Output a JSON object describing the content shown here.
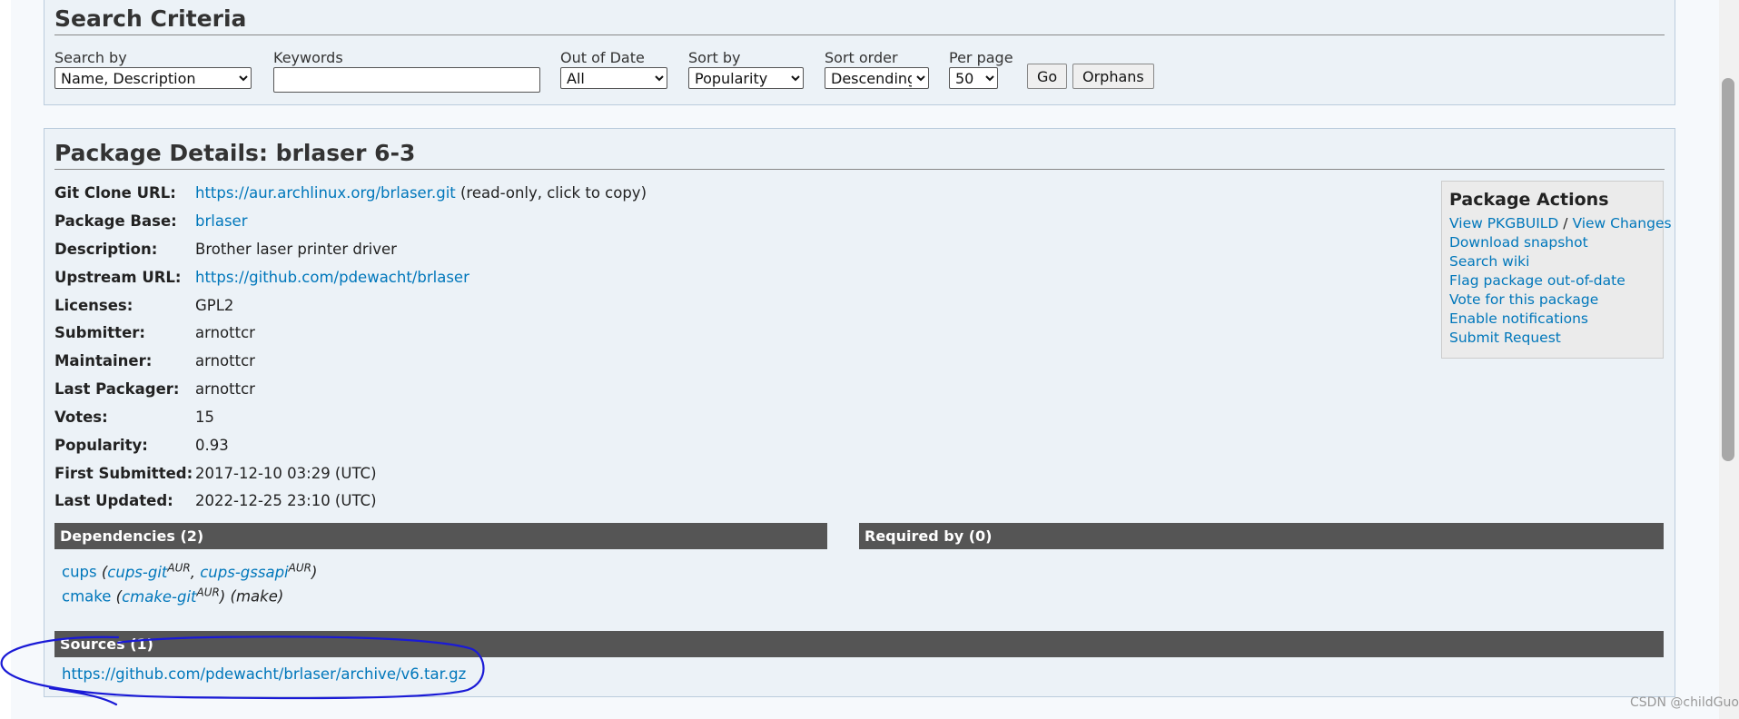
{
  "search": {
    "heading": "Search Criteria",
    "search_by": {
      "label": "Search by",
      "value": "Name, Description"
    },
    "keywords": {
      "label": "Keywords",
      "value": ""
    },
    "out_of_date": {
      "label": "Out of Date",
      "value": "All"
    },
    "sort_by": {
      "label": "Sort by",
      "value": "Popularity"
    },
    "sort_order": {
      "label": "Sort order",
      "value": "Descending"
    },
    "per_page": {
      "label": "Per page",
      "value": "50"
    },
    "go_label": "Go",
    "orphans_label": "Orphans"
  },
  "details": {
    "heading": "Package Details: brlaser 6-3",
    "rows": [
      {
        "label": "Git Clone URL:",
        "value": "https://aur.archlinux.org/brlaser.git",
        "extra": " (read-only, click to copy)"
      },
      {
        "label": "Package Base:",
        "value": "brlaser"
      },
      {
        "label": "Description:",
        "value": "Brother laser printer driver"
      },
      {
        "label": "Upstream URL:",
        "value": "https://github.com/pdewacht/brlaser"
      },
      {
        "label": "Licenses:",
        "value": "GPL2"
      },
      {
        "label": "Submitter:",
        "value": "arnottcr"
      },
      {
        "label": "Maintainer:",
        "value": "arnottcr"
      },
      {
        "label": "Last Packager:",
        "value": "arnottcr"
      },
      {
        "label": "Votes:",
        "value": "15"
      },
      {
        "label": "Popularity:",
        "value": "0.93"
      },
      {
        "label": "First Submitted:",
        "value": "2017-12-10 03:29 (UTC)"
      },
      {
        "label": "Last Updated:",
        "value": "2022-12-25 23:10 (UTC)"
      }
    ]
  },
  "actions": {
    "title": "Package Actions",
    "view_pkgbuild": "View PKGBUILD",
    "separator": " / ",
    "view_changes": "View Changes",
    "download_snapshot": "Download snapshot",
    "search_wiki": "Search wiki",
    "flag_out_of_date": "Flag package out-of-date",
    "vote": "Vote for this package",
    "enable_notifications": "Enable notifications",
    "submit_request": "Submit Request"
  },
  "dependencies": {
    "title": "Dependencies (2)",
    "dep1": {
      "name": "cups",
      "alt1": "cups-git",
      "alt2": "cups-gssapi",
      "aur": "AUR"
    },
    "dep2": {
      "name": "cmake",
      "alt1": "cmake-git",
      "aur": "AUR",
      "note": "(make)"
    }
  },
  "required_by": {
    "title": "Required by (0)"
  },
  "sources": {
    "title": "Sources (1)",
    "url": "https://github.com/pdewacht/brlaser/archive/v6.tar.gz"
  },
  "watermark": "CSDN @childGuo",
  "colors": {
    "link": "#0077bb",
    "bar": "#555555",
    "panel": "#ecf2f7",
    "annotation": "#1a1ad6"
  }
}
